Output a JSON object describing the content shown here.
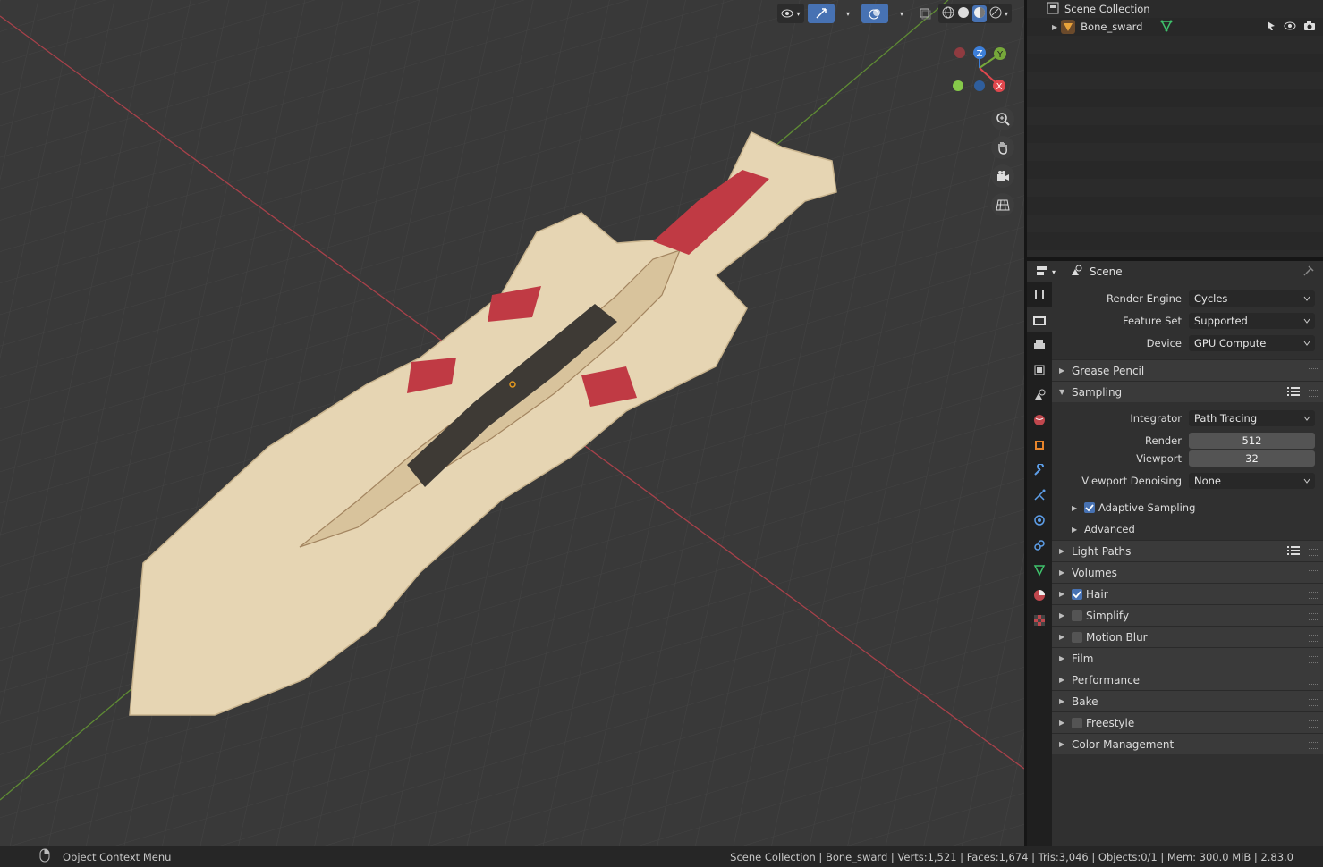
{
  "viewport": {
    "header_icons": [
      "visibility-icon",
      "gizmo-icon",
      "overlay-icon",
      "xray-icon",
      "wireframe-shading-icon",
      "solid-shading-icon",
      "material-shading-icon",
      "rendered-shading-icon"
    ],
    "gizmo": {
      "z": "Z",
      "y": "Y",
      "x": "X"
    },
    "nav_tools": [
      "zoom-icon",
      "pan-hand-icon",
      "camera-icon",
      "grid-view-icon"
    ]
  },
  "outliner": {
    "root": "Scene Collection",
    "items": [
      {
        "label": "Bone_sward"
      }
    ]
  },
  "properties": {
    "header_title": "Scene",
    "render_engine_label": "Render Engine",
    "render_engine": "Cycles",
    "feature_set_label": "Feature Set",
    "feature_set": "Supported",
    "device_label": "Device",
    "device": "GPU Compute",
    "panels": {
      "grease_pencil": "Grease Pencil",
      "sampling": "Sampling",
      "light_paths": "Light Paths",
      "volumes": "Volumes",
      "hair": "Hair",
      "simplify": "Simplify",
      "motion_blur": "Motion Blur",
      "film": "Film",
      "performance": "Performance",
      "bake": "Bake",
      "freestyle": "Freestyle",
      "color_management": "Color Management"
    },
    "sampling": {
      "integrator_label": "Integrator",
      "integrator": "Path Tracing",
      "render_label": "Render",
      "render": "512",
      "viewport_label": "Viewport",
      "viewport": "32",
      "denoise_label": "Viewport Denoising",
      "denoise": "None",
      "adaptive": "Adaptive Sampling",
      "advanced": "Advanced"
    },
    "checks": {
      "hair": true,
      "simplify": false,
      "motion_blur": false,
      "freestyle": false,
      "adaptive": true
    }
  },
  "statusbar": {
    "left": "Object Context Menu",
    "right": "Scene Collection | Bone_sward | Verts:1,521 | Faces:1,674 | Tris:3,046 | Objects:0/1 | Mem: 300.0 MiB | 2.83.0"
  },
  "colors": {
    "accent": "#4772b3",
    "axis_x": "#e0474d",
    "axis_y": "#76a83a",
    "axis_z": "#3d7fd9",
    "bone": "#e6d5b3",
    "wrap": "#c03a44"
  }
}
